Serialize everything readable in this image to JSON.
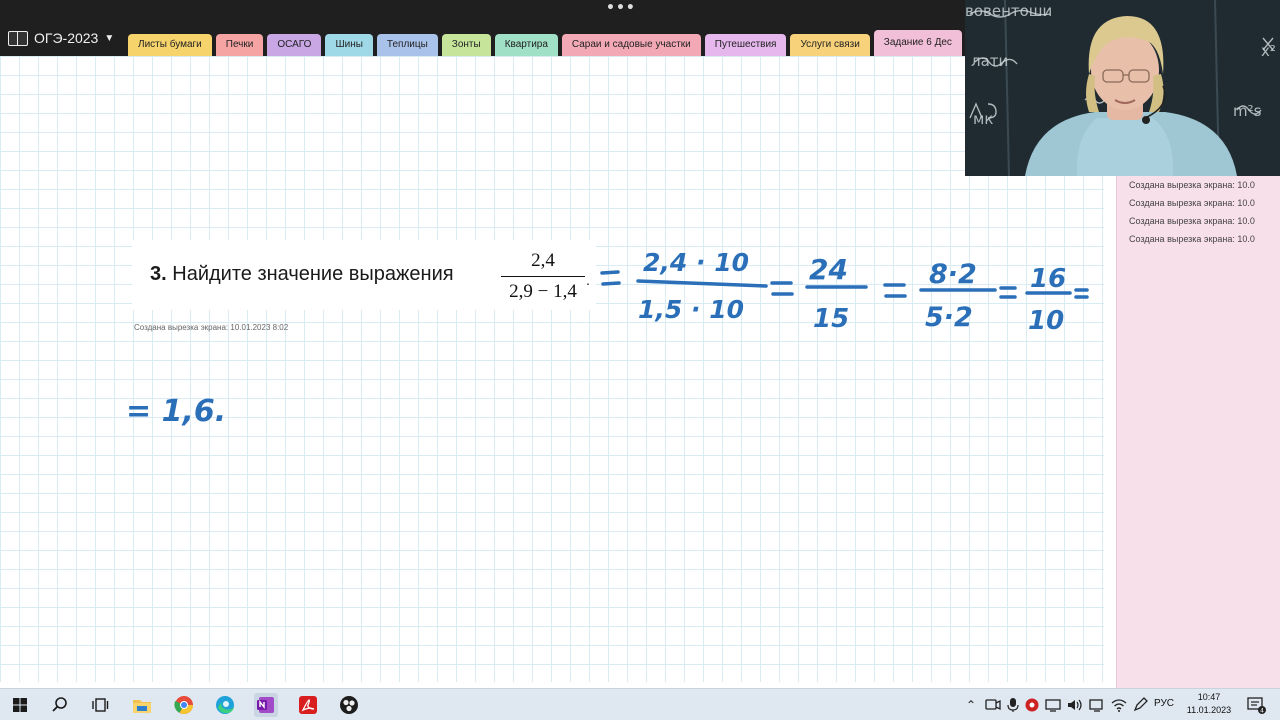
{
  "window": {
    "menu_dots": "•••"
  },
  "notebook": {
    "name": "ОГЭ-2023"
  },
  "tabs": [
    {
      "label": "Листы бумаги",
      "color": "#f6d36b"
    },
    {
      "label": "Печки",
      "color": "#f5a3a3"
    },
    {
      "label": "ОСАГО",
      "color": "#c9a6e4"
    },
    {
      "label": "Шины",
      "color": "#9fd8e6"
    },
    {
      "label": "Теплицы",
      "color": "#a9c2ea"
    },
    {
      "label": "Зонты",
      "color": "#c6e59a"
    },
    {
      "label": "Квартира",
      "color": "#9fe0c7"
    },
    {
      "label": "Сараи и садовые участки",
      "color": "#f3a9b5"
    },
    {
      "label": "Путешествия",
      "color": "#e5b7ec"
    },
    {
      "label": "Услуги связи",
      "color": "#f7d27a"
    },
    {
      "label": "Задание 6 Дес",
      "color": "#f2bfd8",
      "active": true
    }
  ],
  "problem": {
    "number": "3.",
    "text": "Найдите значение выражения",
    "fraction_numerator": "2,4",
    "fraction_denominator": "2,9 − 1,4",
    "period": ".",
    "clip_label": "Создана вырезка экрана: 10.01.2023 8:02"
  },
  "handwriting": {
    "step1_num": "2,4 · 10",
    "step1_den": "1,5 · 10",
    "step2_num": "24",
    "step2_den": "15",
    "step3_num": "8·2",
    "step3_den": "5·2",
    "step4_num": "16",
    "step4_den": "10",
    "result": "= 1,6."
  },
  "sidebar_clips": [
    "Создана вырезка экрана: 10.0",
    "Создана вырезка экрана: 10.0",
    "Создана вырезка экрана: 10.0",
    "Создана вырезка экрана: 10.0"
  ],
  "webcam": {
    "board_words": [
      "вовентоши",
      "лати",
      "мк",
      "m²s",
      "x²"
    ]
  },
  "taskbar": {
    "apps": [
      "windows-start",
      "search",
      "task-view",
      "file-explorer",
      "chrome",
      "edge",
      "onenote",
      "acrobat",
      "obs"
    ],
    "language": "РУС",
    "time": "10:47",
    "date": "11.01.2023",
    "notification_count": "4"
  },
  "colors": {
    "ink": "#2a6fb8",
    "page_grid": "#d9ecf4",
    "side_panel": "#f8e0ea"
  }
}
